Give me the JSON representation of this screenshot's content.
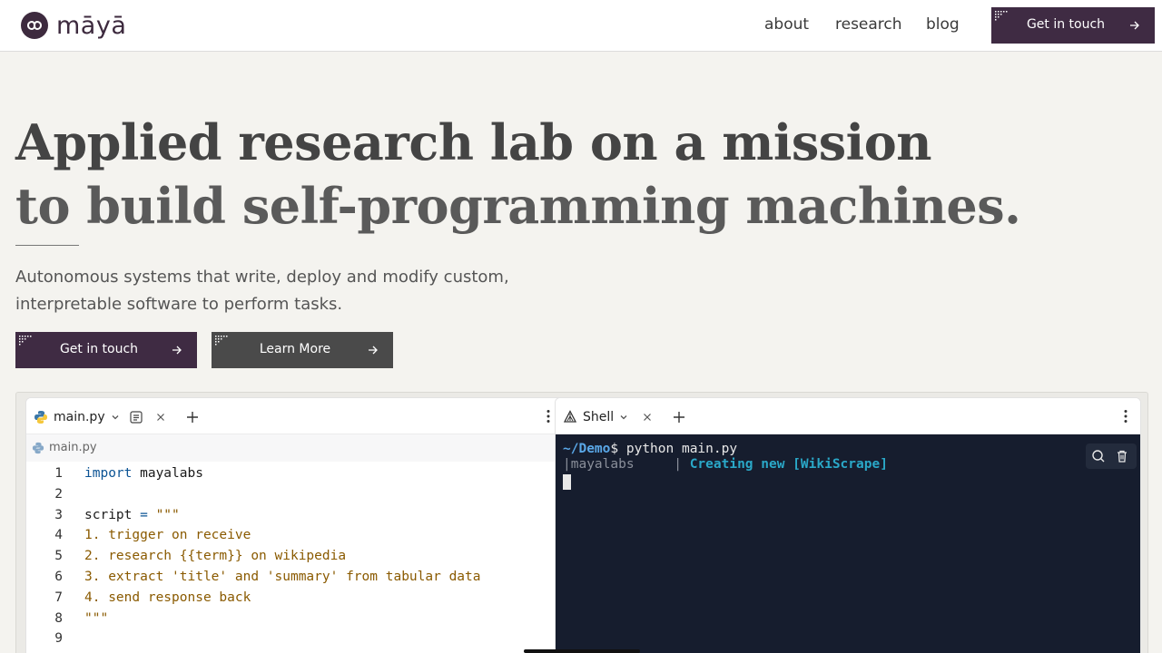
{
  "brand": {
    "name": "māyā"
  },
  "nav": {
    "links": [
      "about",
      "research",
      "blog"
    ],
    "cta_label": "Get in touch"
  },
  "hero": {
    "title_line1": "Applied research lab on a mission",
    "title_line2": "to build self-programming machines.",
    "subtitle_line1": "Autonomous systems that write, deploy and modify custom,",
    "subtitle_line2": "interpretable software to perform tasks.",
    "cta_primary": "Get in touch",
    "cta_secondary": "Learn More"
  },
  "editor": {
    "tab_label": "main.py",
    "breadcrumb": "main.py",
    "lines": [
      {
        "n": "1",
        "text": "import mayalabs"
      },
      {
        "n": "2",
        "text": ""
      },
      {
        "n": "3",
        "text": "script = \"\"\""
      },
      {
        "n": "4",
        "text": "1. trigger on receive"
      },
      {
        "n": "5",
        "text": "2. research {{term}} on wikipedia"
      },
      {
        "n": "6",
        "text": "3. extract 'title' and 'summary' from tabular data"
      },
      {
        "n": "7",
        "text": "4. send response back"
      },
      {
        "n": "8",
        "text": "\"\"\""
      },
      {
        "n": "9",
        "text": ""
      }
    ]
  },
  "shell": {
    "tab_label": "Shell",
    "prompt_path": "~/Demo",
    "prompt_symbol": "$",
    "command": " python main.py",
    "output_source": "|mayalabs     | ",
    "output_text": "Creating new [WikiScrape]"
  },
  "colors": {
    "brand_purple": "#3f2b43",
    "button_gray": "#4a4a4a",
    "terminal_bg": "#161d2e",
    "page_bg": "#f4f3ef"
  }
}
